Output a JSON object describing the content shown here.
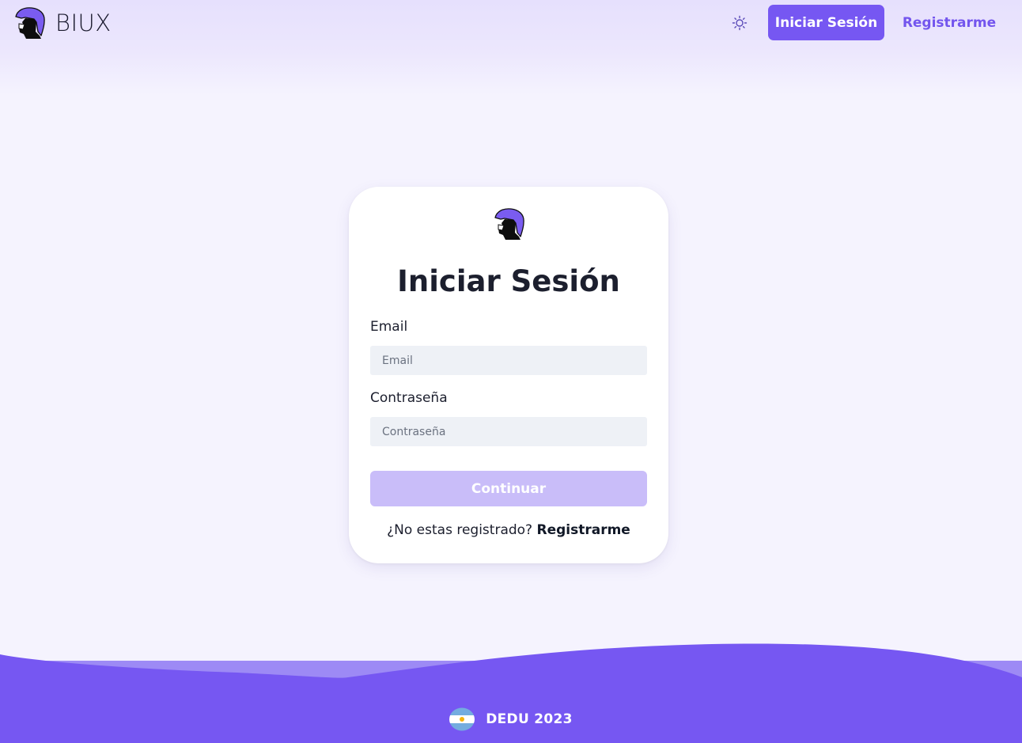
{
  "app": {
    "name": "BIUX"
  },
  "header": {
    "theme_icon": "sun-icon",
    "login_label": "Iniciar Sesión",
    "register_label": "Registrarme",
    "accent_color": "#7657f2"
  },
  "login_card": {
    "logo_icon": "helmet-logo",
    "title": "Iniciar Sesión",
    "email": {
      "label": "Email",
      "placeholder": "Email",
      "value": ""
    },
    "password": {
      "label": "Contraseña",
      "placeholder": "Contraseña",
      "value": ""
    },
    "submit_label": "Continuar",
    "signup_prompt": "¿No estas registrado?",
    "signup_link": "Registrarme"
  },
  "footer": {
    "flag_icon": "argentina-flag-icon",
    "text": "DEDU 2023",
    "background_color": "#7657f2"
  }
}
